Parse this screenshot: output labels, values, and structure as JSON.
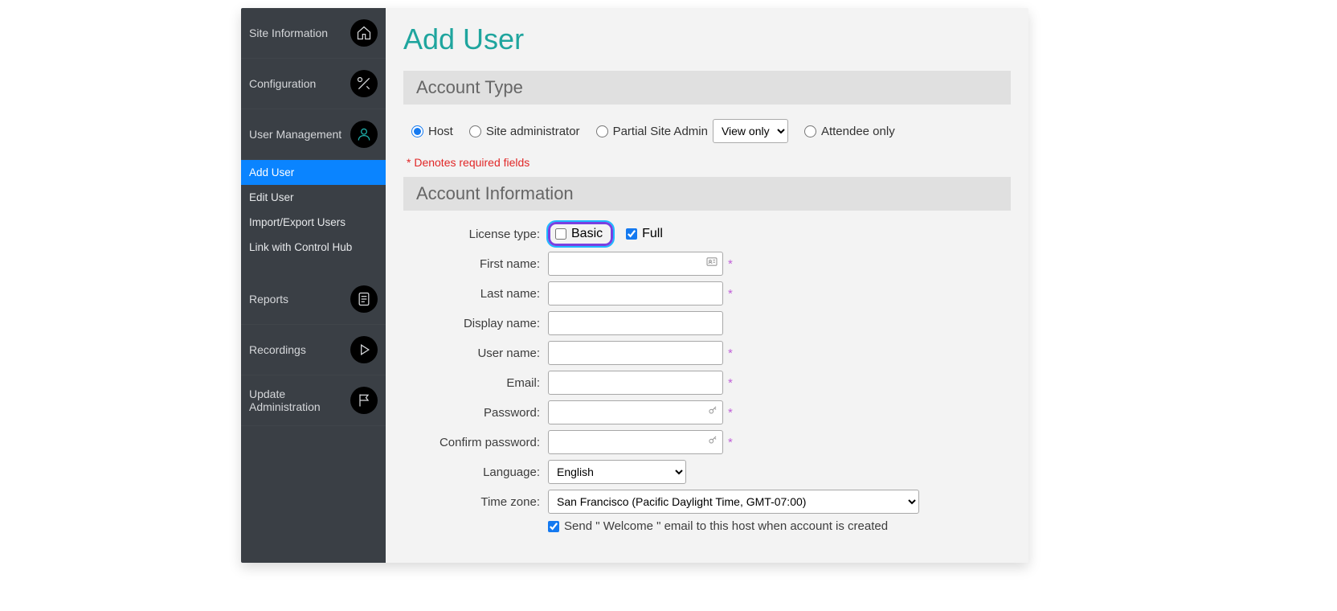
{
  "sidebar": {
    "site_info": "Site Information",
    "configuration": "Configuration",
    "user_management": "User Management",
    "reports": "Reports",
    "recordings": "Recordings",
    "update_admin": "Update Administration",
    "sub_add_user": "Add User",
    "sub_edit_user": "Edit User",
    "sub_import_export": "Import/Export Users",
    "sub_link_hub": "Link with Control Hub"
  },
  "page": {
    "title": "Add User",
    "required_note": "* Denotes required fields"
  },
  "account_type": {
    "header": "Account Type",
    "host": "Host",
    "site_admin": "Site administrator",
    "partial_admin": "Partial Site Admin",
    "partial_value": "View only",
    "attendee": "Attendee only"
  },
  "account_info": {
    "header": "Account Information",
    "license_label": "License type:",
    "basic": "Basic",
    "full": "Full",
    "first_name": "First name:",
    "last_name": "Last name:",
    "display_name": "Display name:",
    "user_name": "User name:",
    "email": "Email:",
    "password": "Password:",
    "confirm_password": "Confirm password:",
    "language": "Language:",
    "language_value": "English",
    "timezone": "Time zone:",
    "timezone_value": "San Francisco (Pacific Daylight Time, GMT-07:00)",
    "welcome_email": "Send \" Welcome \"  email to this host when account is created"
  }
}
